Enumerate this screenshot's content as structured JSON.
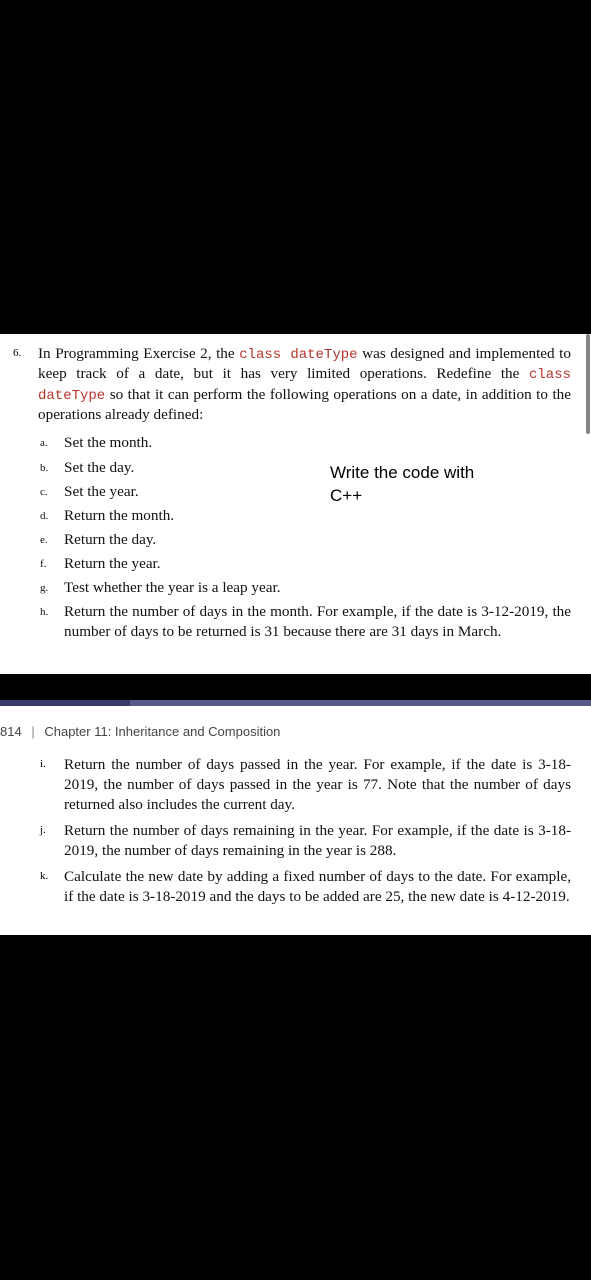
{
  "question": {
    "number": "6.",
    "intro_1": "In Programming Exercise 2, the ",
    "code_1": "class dateType",
    "intro_2": " was designed and implemented to keep track of a date, but it has very limited operations. Redefine the ",
    "code_2": "class dateType",
    "intro_3": " so that it can perform the following operations on a date, in addition to the operations already defined:"
  },
  "annotation": {
    "line1": "Write the code with",
    "line2": "C++"
  },
  "items1": [
    {
      "label": "a.",
      "text": "Set the month."
    },
    {
      "label": "b.",
      "text": "Set the day."
    },
    {
      "label": "c.",
      "text": "Set the year."
    },
    {
      "label": "d.",
      "text": "Return the month."
    },
    {
      "label": "e.",
      "text": "Return the day."
    },
    {
      "label": "f.",
      "text": "Return the year."
    },
    {
      "label": "g.",
      "text": "Test whether the year is a leap year."
    },
    {
      "label": "h.",
      "text": "Return the number of days in the month. For example, if the date is 3-12-2019, the number of days to be returned is 31 because there are 31 days in March."
    }
  ],
  "chapter": {
    "page_num": "814",
    "separator": "|",
    "title": "Chapter 11: Inheritance and Composition"
  },
  "items2": [
    {
      "label": "i.",
      "text": "Return the number of days passed in the year. For example, if the date is 3-18-2019, the number of days passed in the year is 77. Note that the number of days returned also includes the current day."
    },
    {
      "label": "j.",
      "text": "Return the number of days remaining in the year. For example, if the date is 3-18-2019, the number of days remaining in the year is 288."
    },
    {
      "label": "k.",
      "text": "Calculate the new date by adding a fixed number of days to the date. For example, if the date is 3-18-2019 and the days to be added are 25, the new date is 4-12-2019."
    }
  ]
}
